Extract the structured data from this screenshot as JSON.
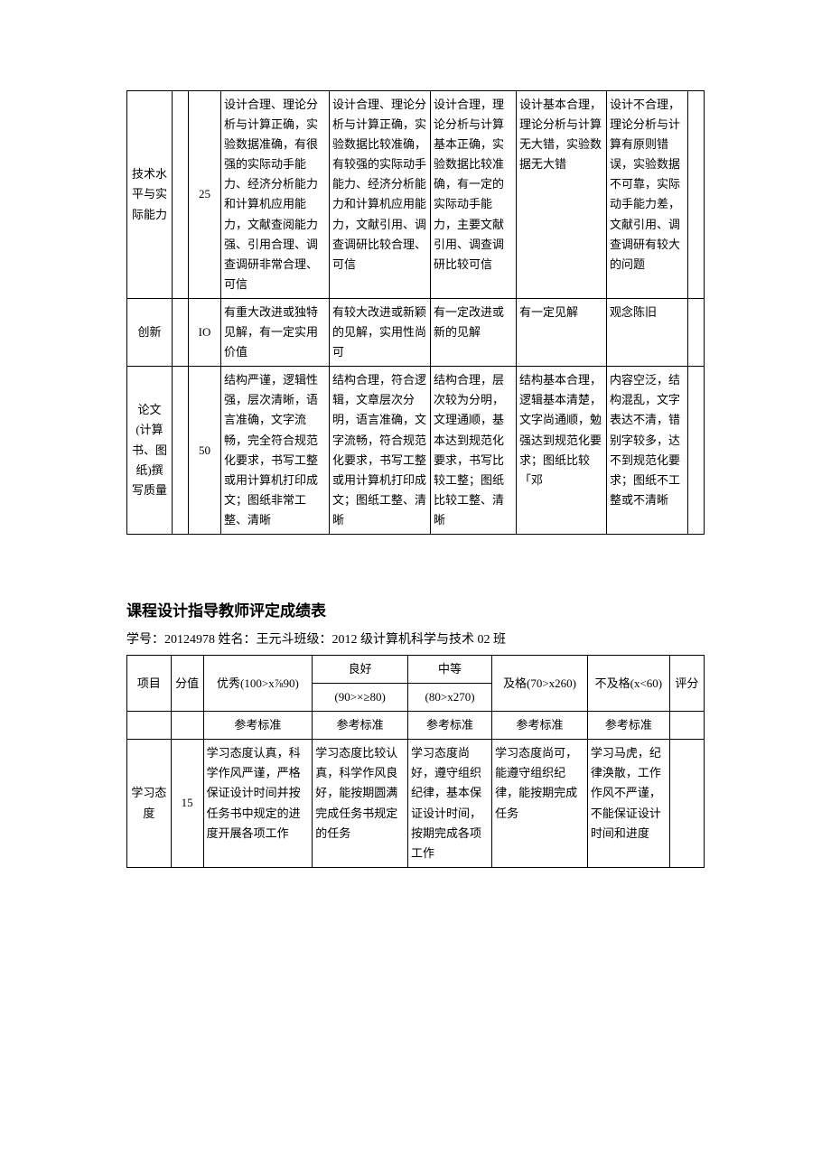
{
  "upper_table": {
    "rows": [
      {
        "label": "技术水平与实际能力",
        "score": "25",
        "c1": "设计合理、理论分析与计算正确，实验数据准确，有很强的实际动手能力、经济分析能力和计算机应用能力，文献查阅能力强、引用合理、调查调研非常合理、可信",
        "c2": "设计合理、理论分析与计算正确，实验数据比较准确，有较强的实际动手能力、经济分析能力和计算机应用能力，文献引用、调查调研比较合理、可信",
        "c3": "设计合理，理论分析与计算基本正确，实验数据比较准确，有一定的实际动手能力，主要文献引用、调查调研比较可信",
        "c4": "设计基本合理，理论分析与计算无大错，实验数据无大错",
        "c5": "设计不合理，理论分析与计算有原则错误，实验数据不可靠，实际动手能力差，文献引用、调查调研有较大的问题"
      },
      {
        "label": "创新",
        "score": "IO",
        "c1": "有重大改进或独特见解，有一定实用价值",
        "c2": "有较大改进或新颖的见解，实用性尚可",
        "c3": "有一定改进或新的见解",
        "c4": "有一定见解",
        "c5": "观念陈旧"
      },
      {
        "label": "论文(计算书、图纸)撰写质量",
        "score": "50",
        "c1": "结构严谨，逻辑性强，层次清晰，语言准确，文字流畅，完全符合规范化要求，书写工整或用计算机打印成文；图纸非常工整、清晰",
        "c2": "结构合理，符合逻辑，文章层次分明，语言准确，文字流畅，符合规范化要求，书写工整或用计算机打印成文；图纸工整、清晰",
        "c3": "结构合理，层次较为分明，文理通顺，基本达到规范化要求，书写比较工整；图纸比较工整、清晰",
        "c4": "结构基本合理，逻辑基本清楚，文字尚通顺，勉强达到规范化要求；图纸比较「邓",
        "c5": "内容空泛，结构混乱，文字表达不清，错别字较多，达不到规范化要求；图纸不工整或不清晰"
      }
    ]
  },
  "section_title": "课程设计指导教师评定成绩表",
  "sub_line": "学号：20124978 姓名：王元斗班级：2012 级计算机科学与技术 02 班",
  "lower_table": {
    "header": {
      "col_project": "项目",
      "col_score": "分值",
      "col_excellent": "优秀(100>x⅞90)",
      "col_good_top": "良好",
      "col_good_bottom": "(90>×≥80)",
      "col_mid_top": "中等",
      "col_mid_bottom": "(80>x270)",
      "col_pass": "及格(70>x260)",
      "col_fail": "不及格(x<60)",
      "col_rating": "评分",
      "ref_std": "参考标准"
    },
    "row": {
      "label": "学习态度",
      "score": "15",
      "c1": "学习态度认真，科学作风严谨，严格保证设计时间并按任务书中规定的进度开展各项工作",
      "c2": "学习态度比较认真，科学作风良好，能按期圆满完成任务书规定的任务",
      "c3": "学习态度尚好，遵守组织纪律，基本保证设计时间，按期完成各项工作",
      "c4": "学习态度尚可，能遵守组织纪律，能按期完成任务",
      "c5": "学习马虎，纪律涣散，工作作风不严谨，不能保证设计时间和进度"
    }
  }
}
